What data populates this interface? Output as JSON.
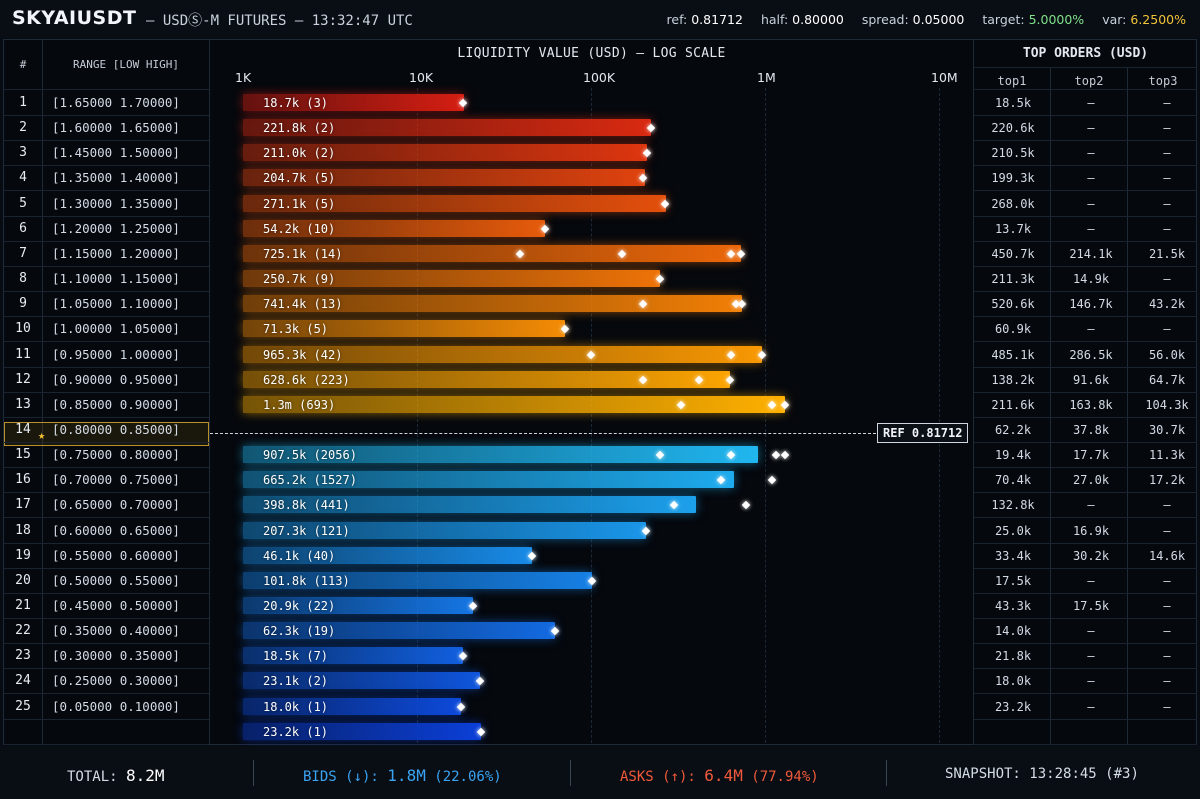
{
  "header": {
    "symbol": "SKYAIUSDT",
    "subtitle": "— USDⓈ-M FUTURES — 13:32:47 UTC",
    "ref_label": "ref:",
    "ref_value": "0.81712",
    "half_label": "half:",
    "half_value": "0.80000",
    "spread_label": "spread:",
    "spread_value": "0.05000",
    "target_label": "target:",
    "target_value": "5.0000%",
    "var_label": "var:",
    "var_value": "6.2500%"
  },
  "table": {
    "col_num": "#",
    "col_range": "RANGE [LOW HIGH]",
    "chart_title": "LIQUIDITY VALUE (USD) — LOG SCALE",
    "axis_ticks": [
      "1K",
      "10K",
      "100K",
      "1M",
      "10M"
    ],
    "top_title": "TOP ORDERS (USD)",
    "top_cols": [
      "top1",
      "top2",
      "top3"
    ],
    "ref_marker": "REF 0.81712"
  },
  "colors": {
    "ask_low": "#d61e12",
    "ask_high": "#ffb000",
    "bid_high": "#20b6f0",
    "bid_low": "#0b3fd8"
  },
  "chart_data": {
    "type": "bar",
    "scale": "log",
    "xlim": [
      1000,
      10000000
    ],
    "rows": [
      {
        "n": "1",
        "range": "[1.65000 1.70000]",
        "side": "ask",
        "value": 18700,
        "label": "18.7k (3)",
        "orders": [
          18500
        ],
        "top": [
          "18.5k",
          "–",
          "–"
        ]
      },
      {
        "n": "2",
        "range": "[1.60000 1.65000]",
        "side": "ask",
        "value": 221800,
        "label": "221.8k (2)",
        "orders": [
          220600
        ],
        "top": [
          "220.6k",
          "–",
          "–"
        ]
      },
      {
        "n": "3",
        "range": "[1.45000 1.50000]",
        "side": "ask",
        "value": 211000,
        "label": "211.0k (2)",
        "orders": [
          210500
        ],
        "top": [
          "210.5k",
          "–",
          "–"
        ]
      },
      {
        "n": "4",
        "range": "[1.35000 1.40000]",
        "side": "ask",
        "value": 204700,
        "label": "204.7k (5)",
        "orders": [
          199300
        ],
        "top": [
          "199.3k",
          "–",
          "–"
        ]
      },
      {
        "n": "5",
        "range": "[1.30000 1.35000]",
        "side": "ask",
        "value": 271100,
        "label": "271.1k (5)",
        "orders": [
          268000
        ],
        "top": [
          "268.0k",
          "–",
          "–"
        ]
      },
      {
        "n": "6",
        "range": "[1.20000 1.25000]",
        "side": "ask",
        "value": 54200,
        "label": "54.2k (10)",
        "orders": [
          54200
        ],
        "top": [
          "13.7k",
          "–",
          "–"
        ]
      },
      {
        "n": "7",
        "range": "[1.15000 1.20000]",
        "side": "ask",
        "value": 725100,
        "label": "725.1k (14)",
        "orders": [
          39000,
          150000,
          640000,
          725100
        ],
        "top": [
          "450.7k",
          "214.1k",
          "21.5k"
        ]
      },
      {
        "n": "8",
        "range": "[1.10000 1.15000]",
        "side": "ask",
        "value": 250700,
        "label": "250.7k (9)",
        "orders": [
          250700
        ],
        "top": [
          "211.3k",
          "14.9k",
          "–"
        ]
      },
      {
        "n": "9",
        "range": "[1.05000 1.10000]",
        "side": "ask",
        "value": 741400,
        "label": "741.4k (13)",
        "orders": [
          200000,
          680000,
          741400
        ],
        "top": [
          "520.6k",
          "146.7k",
          "43.2k"
        ]
      },
      {
        "n": "10",
        "range": "[1.00000 1.05000]",
        "side": "ask",
        "value": 71300,
        "label": "71.3k (5)",
        "orders": [
          71300
        ],
        "top": [
          "60.9k",
          "–",
          "–"
        ]
      },
      {
        "n": "11",
        "range": "[0.95000 1.00000]",
        "side": "ask",
        "value": 965300,
        "label": "965.3k (42)",
        "orders": [
          100000,
          640000,
          965300
        ],
        "top": [
          "485.1k",
          "286.5k",
          "56.0k"
        ]
      },
      {
        "n": "12",
        "range": "[0.90000 0.95000]",
        "side": "ask",
        "value": 628600,
        "label": "628.6k (223)",
        "orders": [
          200000,
          420000,
          628600
        ],
        "top": [
          "138.2k",
          "91.6k",
          "64.7k"
        ]
      },
      {
        "n": "13",
        "range": "[0.85000 0.90000]",
        "side": "ask",
        "value": 1300000,
        "label": "1.3m (693)",
        "orders": [
          330000,
          1100000,
          1300000
        ],
        "top": [
          "211.6k",
          "163.8k",
          "104.3k"
        ]
      },
      {
        "n": "14",
        "range": "[0.80000 0.85000]",
        "side": "ref",
        "value": 0,
        "label": "",
        "orders": [],
        "top": [
          "62.2k",
          "37.8k",
          "30.7k"
        ]
      },
      {
        "n": "15",
        "range": "[0.75000 0.80000]",
        "side": "bid",
        "value": 907500,
        "label": "907.5k (2056)",
        "orders": [
          250000,
          640000,
          1150000,
          1300000
        ],
        "top": [
          "19.4k",
          "17.7k",
          "11.3k"
        ]
      },
      {
        "n": "16",
        "range": "[0.70000 0.75000]",
        "side": "bid",
        "value": 665200,
        "label": "665.2k (1527)",
        "orders": [
          560000,
          1100000
        ],
        "top": [
          "70.4k",
          "27.0k",
          "17.2k"
        ]
      },
      {
        "n": "17",
        "range": "[0.65000 0.70000]",
        "side": "bid",
        "value": 398800,
        "label": "398.8k (441)",
        "orders": [
          300000,
          780000
        ],
        "top": [
          "132.8k",
          "–",
          "–"
        ]
      },
      {
        "n": "18",
        "range": "[0.60000 0.65000]",
        "side": "bid",
        "value": 207300,
        "label": "207.3k (121)",
        "orders": [
          207300
        ],
        "top": [
          "25.0k",
          "16.9k",
          "–"
        ]
      },
      {
        "n": "19",
        "range": "[0.55000 0.60000]",
        "side": "bid",
        "value": 46100,
        "label": "46.1k (40)",
        "orders": [
          46100
        ],
        "top": [
          "33.4k",
          "30.2k",
          "14.6k"
        ]
      },
      {
        "n": "20",
        "range": "[0.50000 0.55000]",
        "side": "bid",
        "value": 101800,
        "label": "101.8k (113)",
        "orders": [
          101800
        ],
        "top": [
          "17.5k",
          "–",
          "–"
        ]
      },
      {
        "n": "21",
        "range": "[0.45000 0.50000]",
        "side": "bid",
        "value": 20900,
        "label": "20.9k (22)",
        "orders": [
          20900
        ],
        "top": [
          "43.3k",
          "17.5k",
          "–"
        ]
      },
      {
        "n": "22",
        "range": "[0.35000 0.40000]",
        "side": "bid",
        "value": 62300,
        "label": "62.3k (19)",
        "orders": [
          62300
        ],
        "top": [
          "14.0k",
          "–",
          "–"
        ]
      },
      {
        "n": "23",
        "range": "[0.30000 0.35000]",
        "side": "bid",
        "value": 18500,
        "label": "18.5k (7)",
        "orders": [
          18500
        ],
        "top": [
          "21.8k",
          "–",
          "–"
        ]
      },
      {
        "n": "24",
        "range": "[0.25000 0.30000]",
        "side": "bid",
        "value": 23100,
        "label": "23.1k (2)",
        "orders": [
          23100
        ],
        "top": [
          "18.0k",
          "–",
          "–"
        ]
      },
      {
        "n": "25",
        "range": "[0.05000 0.10000]",
        "side": "bid",
        "value": 18000,
        "label": "18.0k (1)",
        "orders": [
          18000
        ],
        "top": [
          "23.2k",
          "–",
          "–"
        ]
      },
      {
        "n": "",
        "range": "",
        "side": "bid",
        "value": 23200,
        "label": "23.2k (1)",
        "orders": [
          23200
        ],
        "top": [
          "",
          "",
          ""
        ]
      }
    ]
  },
  "footer": {
    "total_label": "TOTAL:",
    "total_value": "8.2M",
    "bids_label": "BIDS (↓):",
    "bids_value": "1.8M",
    "bids_pct": "(22.06%)",
    "asks_label": "ASKS (↑):",
    "asks_value": "6.4M",
    "asks_pct": "(77.94%)",
    "snapshot_label": "SNAPSHOT:",
    "snapshot_value": "13:28:45 (#3)"
  }
}
